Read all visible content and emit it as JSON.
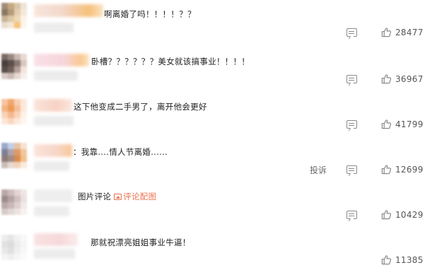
{
  "comments": [
    {
      "text": "啊离婚了吗！！！！？？",
      "likes": "28477",
      "avatar": [
        "#a08d77",
        "#c9a87e",
        "#d8c5a8",
        "#efe4d6",
        "#8b775f",
        "#b49a7a",
        "#e3cfae",
        "#f3e9db",
        "#c7b498",
        "#ddc9a6",
        "#f0d9b6",
        "#fbf3e6",
        "#e9ddd0",
        "#f4e7d6",
        "#f6c57c",
        "#fdf6ec"
      ],
      "name_color": "#f6dfd6"
    },
    {
      "text": "卧槽？？？？？？美女就该搞事业！！！！",
      "likes": "36967",
      "avatar": [
        "#7b6a62",
        "#9a8782",
        "#c9b9b3",
        "#ead9d2",
        "#4a3f3c",
        "#5c4f4b",
        "#8a7772",
        "#d8c8c0",
        "#5a4d49",
        "#6e605c",
        "#b39f98",
        "#f1e4de",
        "#d9cbc5",
        "#cbbab3",
        "#e6d7d0",
        "#f7eeea"
      ],
      "name_color": "#f5dde2"
    },
    {
      "text": "这下他变成二手男了，离开他会更好",
      "likes": "41799",
      "avatar": [
        "#f6c5a3",
        "#f3a66d",
        "#f7d0b4",
        "#fbe8dc",
        "#f1b585",
        "#ef9b58",
        "#f5c09a",
        "#fde9da",
        "#f7d3ba",
        "#f5b990",
        "#fad4b8",
        "#fff1e6",
        "#fbe6d8",
        "#fad7bf",
        "#fcebdd",
        "#fff6ef"
      ],
      "name_color": "#f9dcd3"
    },
    {
      "text": "：我靠....情人节离婚......",
      "likes": "12699",
      "report": "投诉",
      "avatar": [
        "#9aa8c8",
        "#c3cfe8",
        "#e6c3a6",
        "#f7e2d0",
        "#7d7f96",
        "#b0a3a8",
        "#e09a62",
        "#f0c69d",
        "#8c7c77",
        "#a08d86",
        "#d98c4d",
        "#f3c08e",
        "#c9bdb9",
        "#e7d9d2",
        "#f2d3b8",
        "#faeadd"
      ],
      "name_color": "#f7dccf"
    },
    {
      "text": "图片评论",
      "link": "评论配图",
      "likes": "10429",
      "avatar": [
        "#b8a8a6",
        "#cdbdbb",
        "#e2d4d2",
        "#efe6e4",
        "#9d8b89",
        "#b6a4a2",
        "#d1c1bf",
        "#ebe0de",
        "#b9a8a7",
        "#c8b8b6",
        "#ddd0ce",
        "#f1e9e7",
        "#d7cbc9",
        "#e2d7d5",
        "#ece3e1",
        "#f7f1f0"
      ],
      "name_color": "#ececec"
    },
    {
      "text": "那就祝漂亮姐姐事业牛逼！",
      "likes": "11385",
      "avatar": [
        "#ededed",
        "#e6e6e6",
        "#f2f2f2",
        "#f8f8f8",
        "#e2e2e2",
        "#dcdcdc",
        "#ececec",
        "#f5f5f5",
        "#e8e8e8",
        "#e0e0e0",
        "#efefef",
        "#f8f8f8",
        "#f4f4f4",
        "#efefef",
        "#f6f6f6",
        "#fbfbfb"
      ],
      "name_color": "#f7dfe0"
    }
  ]
}
